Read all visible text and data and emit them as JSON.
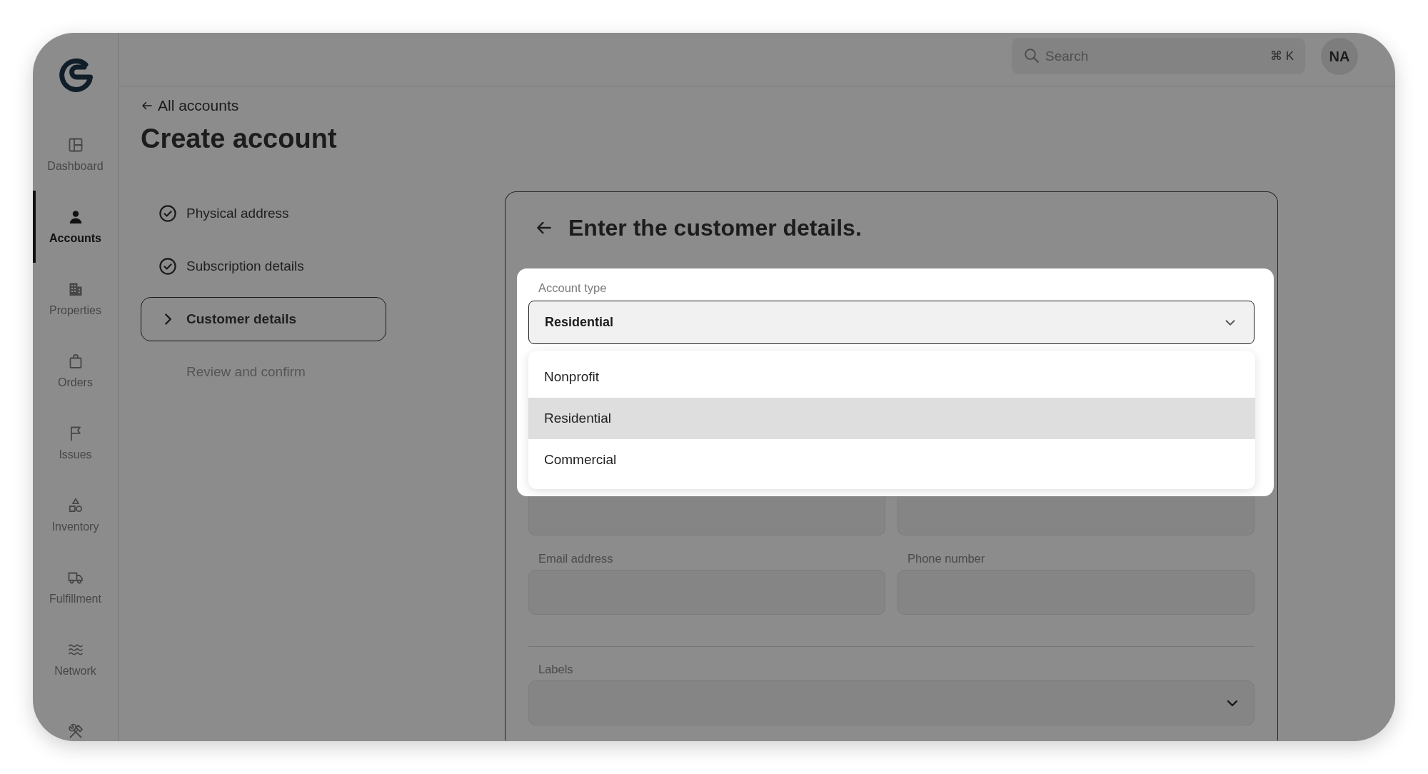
{
  "sidebar": {
    "items": [
      {
        "label": "Dashboard",
        "selected": false
      },
      {
        "label": "Accounts",
        "selected": true
      },
      {
        "label": "Properties",
        "selected": false
      },
      {
        "label": "Orders",
        "selected": false
      },
      {
        "label": "Issues",
        "selected": false
      },
      {
        "label": "Inventory",
        "selected": false
      },
      {
        "label": "Fulfillment",
        "selected": false
      },
      {
        "label": "Network",
        "selected": false
      },
      {
        "selected": false
      }
    ]
  },
  "header": {
    "search": {
      "placeholder": "Search",
      "shortcut": "⌘ K"
    },
    "avatar": {
      "initials": "NA"
    }
  },
  "page": {
    "back_link": "All accounts",
    "title": "Create account"
  },
  "steps": [
    {
      "label": "Physical address",
      "completed": true,
      "selected": false
    },
    {
      "label": "Subscription details",
      "completed": true,
      "selected": false
    },
    {
      "label": "Customer details",
      "completed": false,
      "selected": true
    },
    {
      "label": "Review and confirm",
      "completed": false,
      "selected": false
    }
  ],
  "card": {
    "title": "Enter the customer details.",
    "account_type": {
      "label": "Account type",
      "value": "Residential",
      "expanded": true,
      "options": [
        {
          "label": "Nonprofit",
          "selected": false
        },
        {
          "label": "Residential",
          "selected": true
        },
        {
          "label": "Commercial",
          "selected": false
        }
      ]
    },
    "rows": [
      {
        "divider": false,
        "fields": [
          {
            "kind": "text"
          },
          {
            "kind": "text"
          }
        ]
      },
      {
        "divider": false,
        "fields": [
          {
            "kind": "text",
            "label": "Email address"
          },
          {
            "kind": "text",
            "label": "Phone number"
          }
        ]
      },
      {
        "divider": true,
        "fields": [
          {
            "kind": "select",
            "label": "Labels"
          }
        ]
      }
    ]
  }
}
